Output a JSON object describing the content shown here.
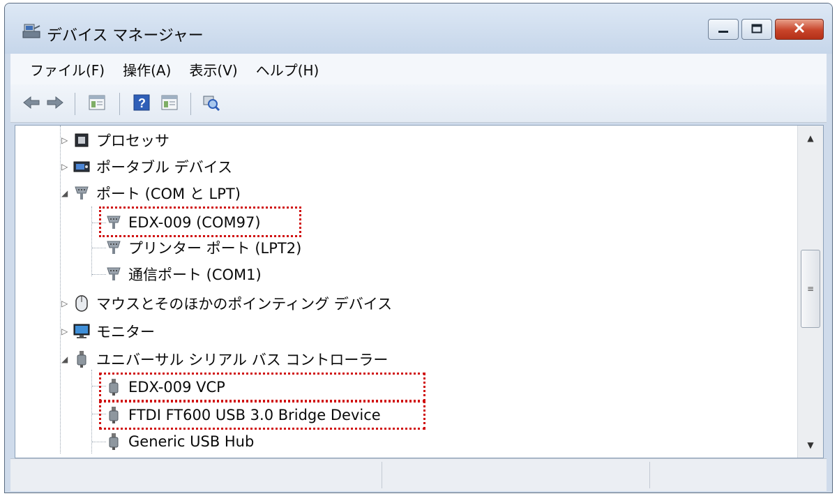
{
  "window": {
    "title": "デバイス マネージャー",
    "icons": {
      "app": "device-manager-icon",
      "minimize": "minimize-icon",
      "maximize": "maximize-icon",
      "close": "close-icon"
    }
  },
  "menu": [
    "ファイル(F)",
    "操作(A)",
    "表示(V)",
    "ヘルプ(H)"
  ],
  "toolbar": [
    "back-arrow-icon",
    "forward-arrow-icon",
    "properties-icon",
    "help-icon",
    "details-icon",
    "scan-hardware-icon"
  ],
  "tree": {
    "items": [
      {
        "label": "プロセッサ",
        "icon": "processor-icon",
        "state": "collapsed"
      },
      {
        "label": "ポータブル デバイス",
        "icon": "portable-device-icon",
        "state": "collapsed"
      },
      {
        "label": "ポート (COM と LPT)",
        "icon": "port-icon",
        "state": "expanded",
        "children": [
          {
            "label": "EDX-009 (COM97)",
            "icon": "port-icon",
            "highlighted": true
          },
          {
            "label": "プリンター ポート (LPT2)",
            "icon": "port-icon"
          },
          {
            "label": "通信ポート (COM1)",
            "icon": "port-icon"
          }
        ]
      },
      {
        "label": "マウスとそのほかのポインティング デバイス",
        "icon": "mouse-icon",
        "state": "collapsed"
      },
      {
        "label": "モニター",
        "icon": "monitor-icon",
        "state": "collapsed"
      },
      {
        "label": "ユニバーサル シリアル バス コントローラー",
        "icon": "usb-icon",
        "state": "expanded",
        "children": [
          {
            "label": "EDX-009 VCP",
            "icon": "usb-icon",
            "highlighted": true
          },
          {
            "label": "FTDI FT600 USB 3.0 Bridge Device",
            "icon": "usb-icon",
            "highlighted": true
          },
          {
            "label": "Generic USB Hub",
            "icon": "usb-icon"
          }
        ]
      }
    ]
  },
  "colors": {
    "highlight": "#d01010",
    "titlebar": "#c6d6ea"
  }
}
